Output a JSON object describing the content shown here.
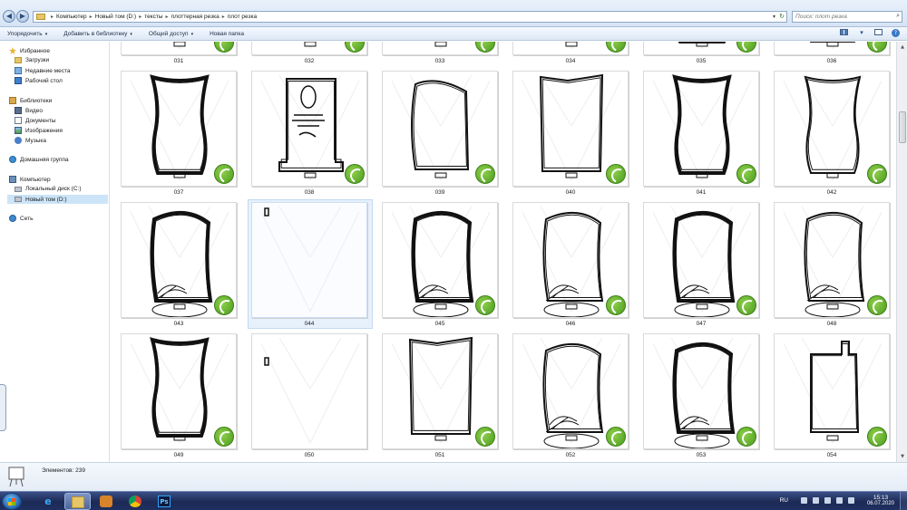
{
  "address": {
    "crumbs": [
      "Компьютер",
      "Новый том (D:)",
      "тексты",
      "плоттерная резка",
      "плот резка"
    ],
    "search_placeholder": "Поиск: плот резка"
  },
  "toolbar": {
    "organize": "Упорядочить",
    "add_to_library": "Добавить в библиотеку",
    "share": "Общий доступ",
    "new_folder": "Новая папка",
    "dropdown_glyph": "▾",
    "help_glyph": "?"
  },
  "sidebar": {
    "favorites": "Избранное",
    "downloads": "Загрузки",
    "recent": "Недавние места",
    "desktop": "Рабочий стол",
    "libraries": "Библиотеки",
    "videos": "Видео",
    "documents": "Документы",
    "images": "Изображения",
    "music": "Музыка",
    "homegroup": "Домашняя группа",
    "computer": "Компьютер",
    "local_disk": "Локальный диск (C:)",
    "new_volume": "Новый том (D:)",
    "network": "Сеть"
  },
  "files": [
    {
      "name": "031"
    },
    {
      "name": "032"
    },
    {
      "name": "033"
    },
    {
      "name": "034"
    },
    {
      "name": "035"
    },
    {
      "name": "036"
    },
    {
      "name": "037"
    },
    {
      "name": "038"
    },
    {
      "name": "039"
    },
    {
      "name": "040"
    },
    {
      "name": "041"
    },
    {
      "name": "042"
    },
    {
      "name": "043"
    },
    {
      "name": "044"
    },
    {
      "name": "045"
    },
    {
      "name": "046"
    },
    {
      "name": "047"
    },
    {
      "name": "048"
    },
    {
      "name": "049"
    },
    {
      "name": "050"
    },
    {
      "name": "051"
    },
    {
      "name": "052"
    },
    {
      "name": "053"
    },
    {
      "name": "054"
    }
  ],
  "selected_file": "044",
  "status": {
    "item_count": "Элементов: 239"
  },
  "taskbar": {
    "lang": "RU",
    "time": "15:13",
    "date": "06.07.2020",
    "ps_label": "Ps"
  },
  "colors": {
    "accent": "#3a78c6",
    "badge_green": "#5fae2a",
    "taskbar": "#1c2a55"
  }
}
